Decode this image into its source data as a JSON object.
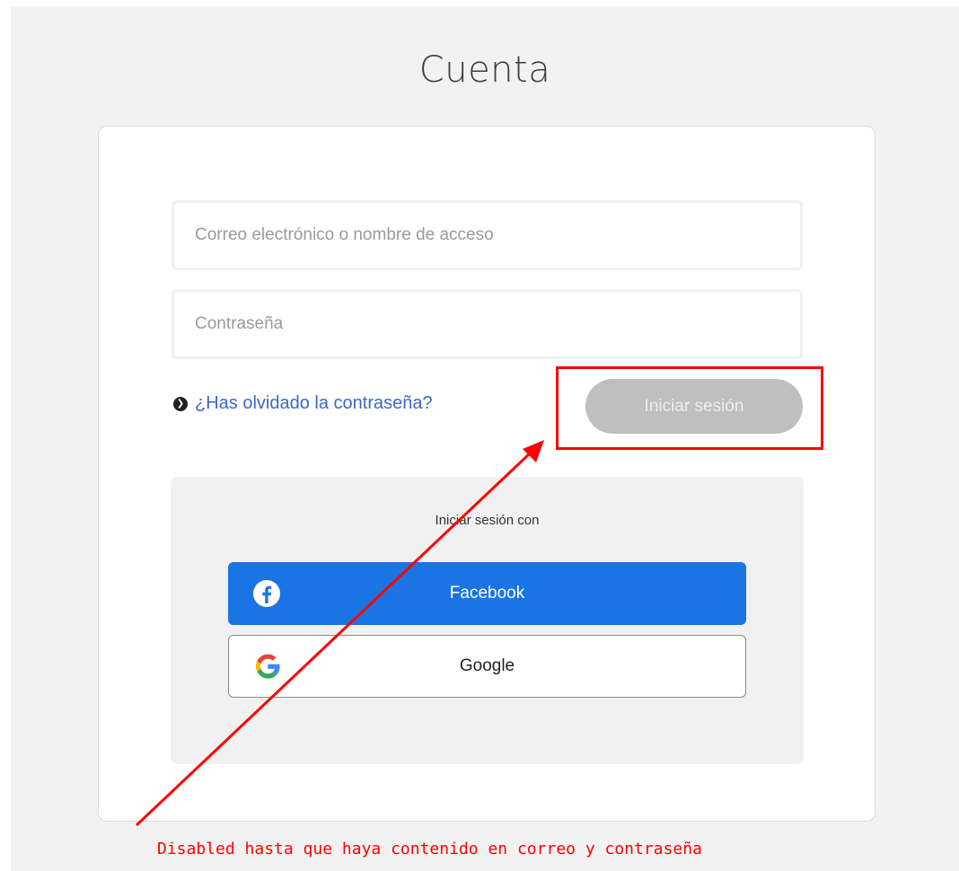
{
  "page": {
    "title": "Cuenta"
  },
  "login_form": {
    "email_placeholder": "Correo electrónico o nombre de acceso",
    "password_placeholder": "Contraseña",
    "forgot_password_link": "¿Has olvidado la contraseña?",
    "forgot_icon": "chevron-right-circle-icon",
    "submit_label": "Iniciar sesión",
    "submit_state": "disabled"
  },
  "social_login": {
    "title": "Iniciar sesión con",
    "providers": [
      {
        "label": "Facebook",
        "icon": "facebook-icon",
        "color": "#1b74e4"
      },
      {
        "label": "Google",
        "icon": "google-icon",
        "color": "#ffffff"
      }
    ]
  },
  "annotation": {
    "note": "Disabled hasta que haya contenido en correo y contraseña",
    "color": "#ff0000"
  }
}
